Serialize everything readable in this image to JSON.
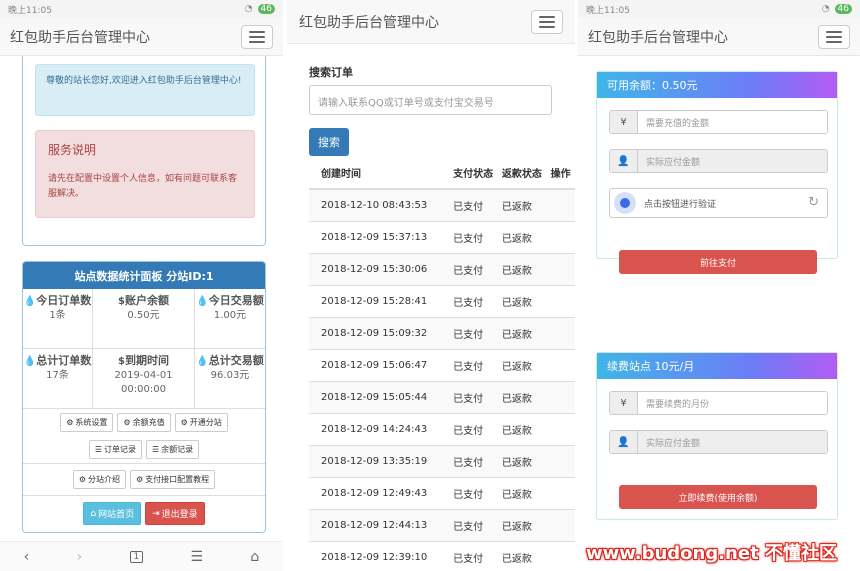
{
  "status": {
    "time": "晚上11:05",
    "battery": "46"
  },
  "app": {
    "title": "红包助手后台管理中心"
  },
  "home": {
    "welcome": "尊敬的站长您好,欢迎进入红包助手后台管理中心!",
    "service_title": "服务说明",
    "service_text": "请先在配置中设置个人信息，如有问题可联系客服解决。",
    "stats_title": "站点数据统计面板 分站ID:1",
    "stats": [
      {
        "icon": "drop-icon",
        "label": "今日订单数",
        "value": "1条"
      },
      {
        "icon": "dollar-icon",
        "label": "账户余额",
        "value": "0.50元"
      },
      {
        "icon": "drop-icon",
        "label": "今日交易额",
        "value": "1.00元"
      },
      {
        "icon": "drop-icon",
        "label": "总计订单数",
        "value": "17条"
      },
      {
        "icon": "dollar-icon",
        "label": "到期时间",
        "value": "2019-04-01 00:00:00"
      },
      {
        "icon": "drop-icon",
        "label": "总计交易额",
        "value": "96.03元"
      }
    ],
    "buttons_row1": [
      "系统设置",
      "余额充值",
      "开通分站"
    ],
    "buttons_row2": [
      "订单记录",
      "余额记录"
    ],
    "buttons_row3": [
      "分站介绍",
      "支付接口配置教程"
    ],
    "home_btn": "网站首页",
    "logout_btn": "退出登录",
    "nav_page": "1"
  },
  "orders": {
    "search_label": "搜索订单",
    "search_placeholder": "请输入联系QQ或订单号或支付宝交易号",
    "search_btn": "搜索",
    "columns": [
      "创建时间",
      "支付状态",
      "返款状态",
      "操作"
    ],
    "rows": [
      [
        "2018-12-10 08:43:53",
        "已支付",
        "已返款"
      ],
      [
        "2018-12-09 15:37:13",
        "已支付",
        "已返款"
      ],
      [
        "2018-12-09 15:30:06",
        "已支付",
        "已返款"
      ],
      [
        "2018-12-09 15:28:41",
        "已支付",
        "已返款"
      ],
      [
        "2018-12-09 15:09:32",
        "已支付",
        "已返款"
      ],
      [
        "2018-12-09 15:06:47",
        "已支付",
        "已返款"
      ],
      [
        "2018-12-09 15:05:44",
        "已支付",
        "已返款"
      ],
      [
        "2018-12-09 14:24:43",
        "已支付",
        "已返款"
      ],
      [
        "2018-12-09 13:35:19",
        "已支付",
        "已返款"
      ],
      [
        "2018-12-09 12:49:43",
        "已支付",
        "已返款"
      ],
      [
        "2018-12-09 12:44:13",
        "已支付",
        "已返款"
      ],
      [
        "2018-12-09 12:39:10",
        "已支付",
        "已返款"
      ]
    ]
  },
  "recharge": {
    "balance_title": "可用余额：0.50元",
    "amount_placeholder": "需要充值的金额",
    "pay_placeholder": "实际应付金额",
    "captcha_text": "点击按钮进行验证",
    "pay_btn": "前往支付",
    "renew_title": "续费站点 10元/月",
    "months_placeholder": "需要续费的月份",
    "renew_pay_placeholder": "实际应付金额",
    "renew_btn": "立即续费(使用余额)",
    "yen": "¥"
  },
  "watermark": "www.budong.net 不懂社区",
  "colors": {
    "primary": "#337ab7",
    "danger": "#d9534f",
    "info": "#5bc0de"
  }
}
